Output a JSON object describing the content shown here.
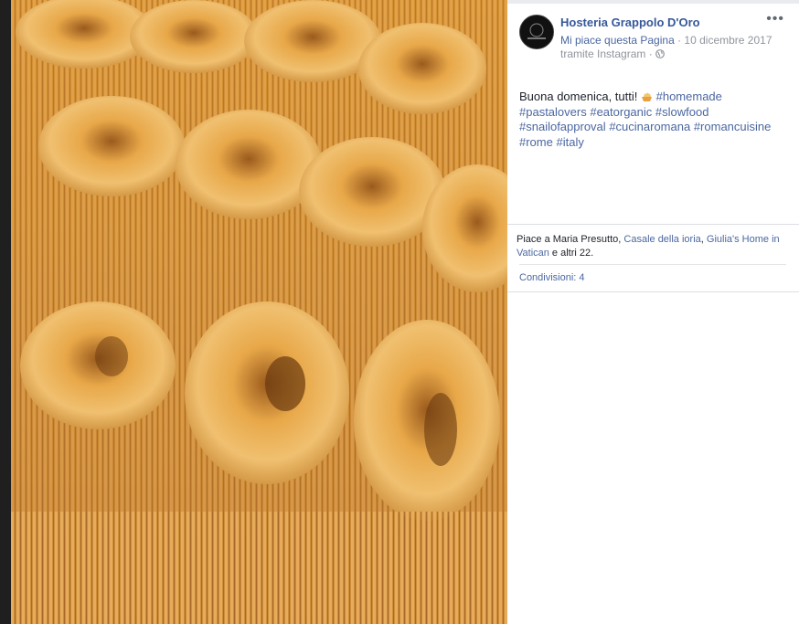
{
  "post": {
    "page_name": "Hosteria Grappolo D'Oro",
    "like_page_label": "Mi piace questa Pagina",
    "separator": " · ",
    "date": "10 dicembre 2017",
    "via_label": "tramite Instagram",
    "via_separator": " · ",
    "more_label": "•••",
    "text_intro": "Buona domenica, tutti! ",
    "hashtags": [
      "#homemade",
      "#pastalovers",
      "#eatorganic",
      "#slowfood",
      "#snailofapproval",
      "#cucinaromana",
      "#romancuisine",
      "#rome",
      "#italy"
    ]
  },
  "reactions": {
    "prefix": "Piace a Maria Presutto, ",
    "liker_2": "Casale della ioria",
    "comma": ", ",
    "liker_3": "Giulia's Home in Vatican",
    "suffix": " e altri 22."
  },
  "shares": {
    "label": "Condivisioni: 4"
  },
  "icons": {
    "globe": "globe-icon",
    "emoji": "pasta-emoji-icon",
    "more": "more-options-icon",
    "avatar": "page-logo"
  },
  "colors": {
    "link": "#365899",
    "meta": "#90949c",
    "text": "#1d2129"
  }
}
